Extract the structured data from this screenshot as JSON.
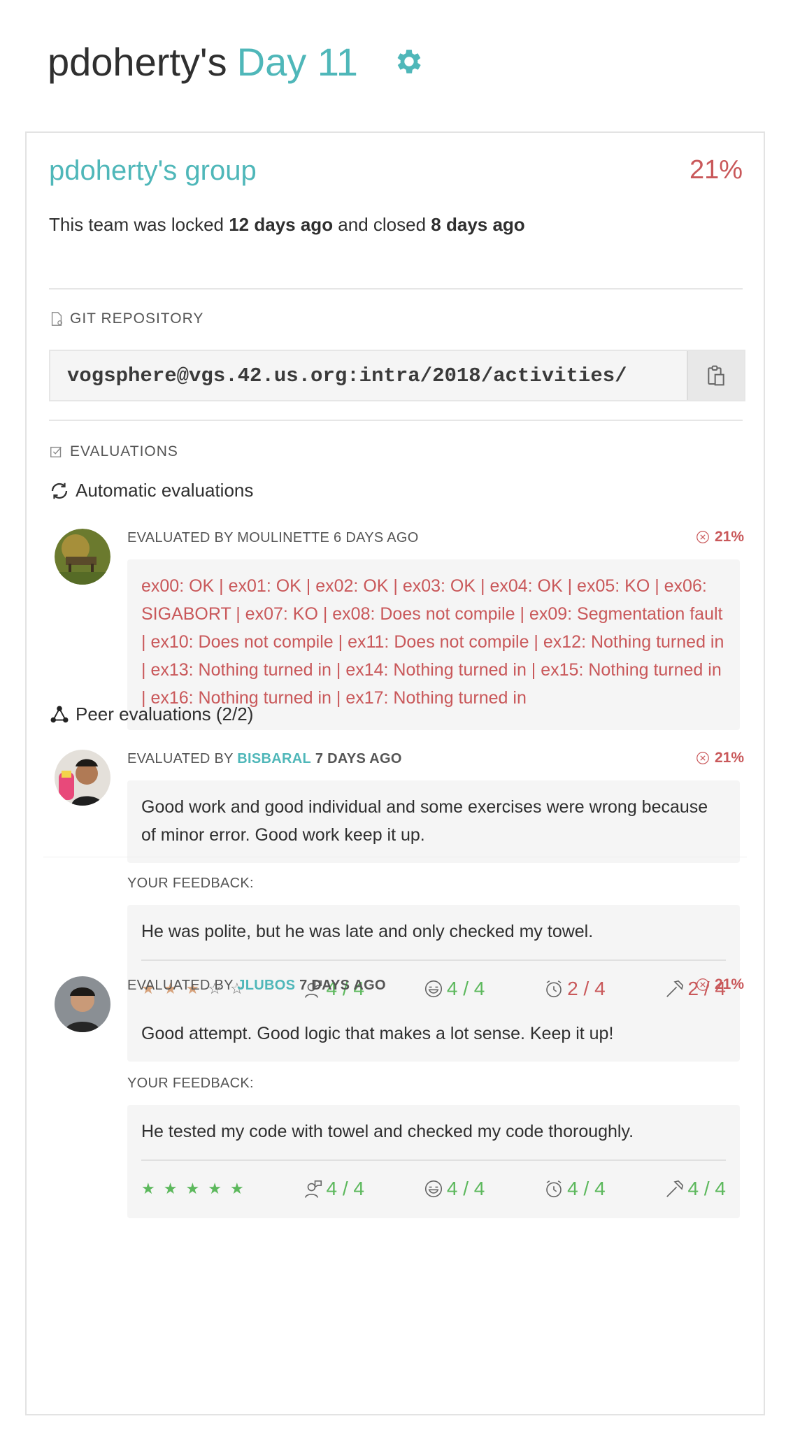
{
  "header": {
    "user": "pdoherty's",
    "day": "Day 11"
  },
  "group": {
    "title": "pdoherty's group",
    "percent": "21%",
    "status_prefix": "This team was locked ",
    "locked_ago": "12 days ago",
    "status_mid": " and closed ",
    "closed_ago": "8 days ago"
  },
  "git": {
    "label": "GIT REPOSITORY",
    "url": "vogsphere@vgs.42.us.org:intra/2018/activities/"
  },
  "evaluations": {
    "label": "EVALUATIONS",
    "automatic_title": "Automatic evaluations",
    "auto": {
      "evaluated_by": "EVALUATED BY MOULINETTE 6 DAYS AGO",
      "percent": "21%",
      "result": "ex00: OK | ex01: OK | ex02: OK | ex03: OK | ex04: OK | ex05: KO | ex06: SIGABORT | ex07: KO | ex08: Does not compile | ex09: Segmentation fault | ex10: Does not compile | ex11: Does not compile | ex12: Nothing turned in | ex13: Nothing turned in | ex14: Nothing turned in | ex15: Nothing turned in | ex16: Nothing turned in | ex17: Nothing turned in"
    },
    "peer_title": "Peer evaluations (2/2)",
    "peers": [
      {
        "prefix": "EVALUATED BY ",
        "login": "BISBARAL",
        "ago": "7 DAYS AGO",
        "percent": "21%",
        "comment": "Good work and good individual and some exercises were wrong because of minor error. Good work keep it up.",
        "feedback_label": "YOUR FEEDBACK:",
        "feedback": "He was polite, but he was late and only checked my towel.",
        "stars": 3,
        "m1": "4 / 4",
        "m2": "4 / 4",
        "m3": "2 / 4",
        "m4": "2 / 4"
      },
      {
        "prefix": "EVALUATED BY ",
        "login": "JLUBOS",
        "ago": "7 DAYS AGO",
        "percent": "21%",
        "comment": "Good attempt. Good logic that makes a lot sense. Keep it up!",
        "feedback_label": "YOUR FEEDBACK:",
        "feedback": "He tested my code with towel and checked my code thoroughly.",
        "stars": 5,
        "m1": "4 / 4",
        "m2": "4 / 4",
        "m3": "4 / 4",
        "m4": "4 / 4"
      }
    ]
  },
  "colors": {
    "accent": "#4fb7b9",
    "danger": "#c9585a",
    "success": "#5cb85c"
  }
}
